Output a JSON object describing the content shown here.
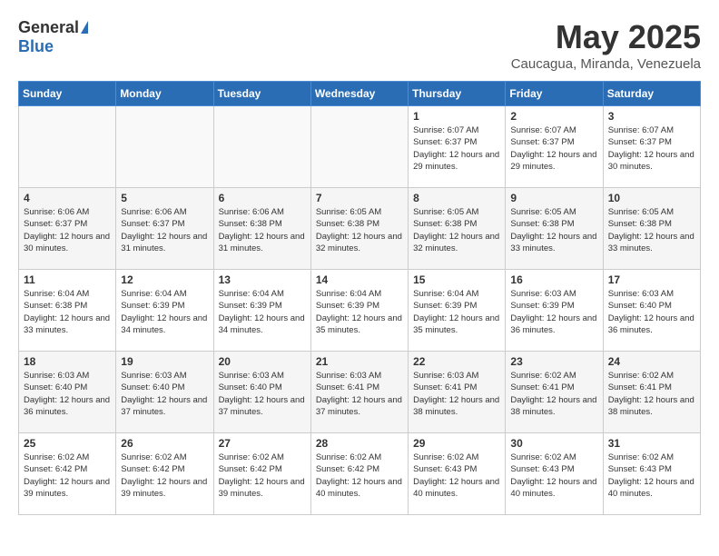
{
  "header": {
    "logo_general": "General",
    "logo_blue": "Blue",
    "month_title": "May 2025",
    "location": "Caucagua, Miranda, Venezuela"
  },
  "weekdays": [
    "Sunday",
    "Monday",
    "Tuesday",
    "Wednesday",
    "Thursday",
    "Friday",
    "Saturday"
  ],
  "weeks": [
    [
      {
        "day": "",
        "info": ""
      },
      {
        "day": "",
        "info": ""
      },
      {
        "day": "",
        "info": ""
      },
      {
        "day": "",
        "info": ""
      },
      {
        "day": "1",
        "info": "Sunrise: 6:07 AM\nSunset: 6:37 PM\nDaylight: 12 hours\nand 29 minutes."
      },
      {
        "day": "2",
        "info": "Sunrise: 6:07 AM\nSunset: 6:37 PM\nDaylight: 12 hours\nand 29 minutes."
      },
      {
        "day": "3",
        "info": "Sunrise: 6:07 AM\nSunset: 6:37 PM\nDaylight: 12 hours\nand 30 minutes."
      }
    ],
    [
      {
        "day": "4",
        "info": "Sunrise: 6:06 AM\nSunset: 6:37 PM\nDaylight: 12 hours\nand 30 minutes."
      },
      {
        "day": "5",
        "info": "Sunrise: 6:06 AM\nSunset: 6:37 PM\nDaylight: 12 hours\nand 31 minutes."
      },
      {
        "day": "6",
        "info": "Sunrise: 6:06 AM\nSunset: 6:38 PM\nDaylight: 12 hours\nand 31 minutes."
      },
      {
        "day": "7",
        "info": "Sunrise: 6:05 AM\nSunset: 6:38 PM\nDaylight: 12 hours\nand 32 minutes."
      },
      {
        "day": "8",
        "info": "Sunrise: 6:05 AM\nSunset: 6:38 PM\nDaylight: 12 hours\nand 32 minutes."
      },
      {
        "day": "9",
        "info": "Sunrise: 6:05 AM\nSunset: 6:38 PM\nDaylight: 12 hours\nand 33 minutes."
      },
      {
        "day": "10",
        "info": "Sunrise: 6:05 AM\nSunset: 6:38 PM\nDaylight: 12 hours\nand 33 minutes."
      }
    ],
    [
      {
        "day": "11",
        "info": "Sunrise: 6:04 AM\nSunset: 6:38 PM\nDaylight: 12 hours\nand 33 minutes."
      },
      {
        "day": "12",
        "info": "Sunrise: 6:04 AM\nSunset: 6:39 PM\nDaylight: 12 hours\nand 34 minutes."
      },
      {
        "day": "13",
        "info": "Sunrise: 6:04 AM\nSunset: 6:39 PM\nDaylight: 12 hours\nand 34 minutes."
      },
      {
        "day": "14",
        "info": "Sunrise: 6:04 AM\nSunset: 6:39 PM\nDaylight: 12 hours\nand 35 minutes."
      },
      {
        "day": "15",
        "info": "Sunrise: 6:04 AM\nSunset: 6:39 PM\nDaylight: 12 hours\nand 35 minutes."
      },
      {
        "day": "16",
        "info": "Sunrise: 6:03 AM\nSunset: 6:39 PM\nDaylight: 12 hours\nand 36 minutes."
      },
      {
        "day": "17",
        "info": "Sunrise: 6:03 AM\nSunset: 6:40 PM\nDaylight: 12 hours\nand 36 minutes."
      }
    ],
    [
      {
        "day": "18",
        "info": "Sunrise: 6:03 AM\nSunset: 6:40 PM\nDaylight: 12 hours\nand 36 minutes."
      },
      {
        "day": "19",
        "info": "Sunrise: 6:03 AM\nSunset: 6:40 PM\nDaylight: 12 hours\nand 37 minutes."
      },
      {
        "day": "20",
        "info": "Sunrise: 6:03 AM\nSunset: 6:40 PM\nDaylight: 12 hours\nand 37 minutes."
      },
      {
        "day": "21",
        "info": "Sunrise: 6:03 AM\nSunset: 6:41 PM\nDaylight: 12 hours\nand 37 minutes."
      },
      {
        "day": "22",
        "info": "Sunrise: 6:03 AM\nSunset: 6:41 PM\nDaylight: 12 hours\nand 38 minutes."
      },
      {
        "day": "23",
        "info": "Sunrise: 6:02 AM\nSunset: 6:41 PM\nDaylight: 12 hours\nand 38 minutes."
      },
      {
        "day": "24",
        "info": "Sunrise: 6:02 AM\nSunset: 6:41 PM\nDaylight: 12 hours\nand 38 minutes."
      }
    ],
    [
      {
        "day": "25",
        "info": "Sunrise: 6:02 AM\nSunset: 6:42 PM\nDaylight: 12 hours\nand 39 minutes."
      },
      {
        "day": "26",
        "info": "Sunrise: 6:02 AM\nSunset: 6:42 PM\nDaylight: 12 hours\nand 39 minutes."
      },
      {
        "day": "27",
        "info": "Sunrise: 6:02 AM\nSunset: 6:42 PM\nDaylight: 12 hours\nand 39 minutes."
      },
      {
        "day": "28",
        "info": "Sunrise: 6:02 AM\nSunset: 6:42 PM\nDaylight: 12 hours\nand 40 minutes."
      },
      {
        "day": "29",
        "info": "Sunrise: 6:02 AM\nSunset: 6:43 PM\nDaylight: 12 hours\nand 40 minutes."
      },
      {
        "day": "30",
        "info": "Sunrise: 6:02 AM\nSunset: 6:43 PM\nDaylight: 12 hours\nand 40 minutes."
      },
      {
        "day": "31",
        "info": "Sunrise: 6:02 AM\nSunset: 6:43 PM\nDaylight: 12 hours\nand 40 minutes."
      }
    ]
  ]
}
